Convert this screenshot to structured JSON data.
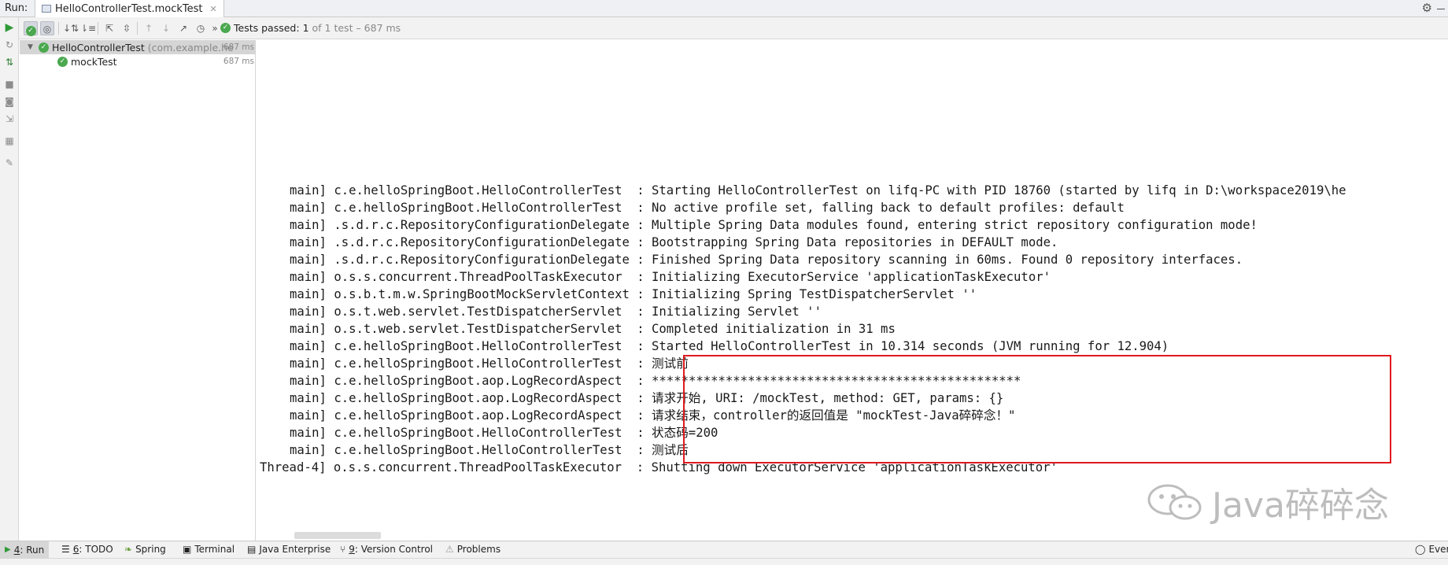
{
  "run_bar": {
    "label": "Run:",
    "tab_title": "HelloControllerTest.mockTest"
  },
  "toolbar": {
    "status_passed": "Tests passed:",
    "status_count": "1",
    "status_rest": "of 1 test – 687 ms",
    "more": "»"
  },
  "tree": {
    "root": {
      "name": "HelloControllerTest",
      "package": "(com.example.he",
      "time": "687 ms"
    },
    "child": {
      "name": "mockTest",
      "time": "687 ms"
    }
  },
  "console": {
    "lines": [
      "main] c.e.helloSpringBoot.HelloControllerTest  : Starting HelloControllerTest on lifq-PC with PID 18760 (started by lifq in D:\\workspace2019\\he",
      "main] c.e.helloSpringBoot.HelloControllerTest  : No active profile set, falling back to default profiles: default",
      "main] .s.d.r.c.RepositoryConfigurationDelegate : Multiple Spring Data modules found, entering strict repository configuration mode!",
      "main] .s.d.r.c.RepositoryConfigurationDelegate : Bootstrapping Spring Data repositories in DEFAULT mode.",
      "main] .s.d.r.c.RepositoryConfigurationDelegate : Finished Spring Data repository scanning in 60ms. Found 0 repository interfaces.",
      "main] o.s.s.concurrent.ThreadPoolTaskExecutor  : Initializing ExecutorService 'applicationTaskExecutor'",
      "main] o.s.b.t.m.w.SpringBootMockServletContext : Initializing Spring TestDispatcherServlet ''",
      "main] o.s.t.web.servlet.TestDispatcherServlet  : Initializing Servlet ''",
      "main] o.s.t.web.servlet.TestDispatcherServlet  : Completed initialization in 31 ms",
      "main] c.e.helloSpringBoot.HelloControllerTest  : Started HelloControllerTest in 10.314 seconds (JVM running for 12.904)",
      "main] c.e.helloSpringBoot.HelloControllerTest  : 测试前",
      "main] c.e.helloSpringBoot.aop.LogRecordAspect  : **************************************************",
      "main] c.e.helloSpringBoot.aop.LogRecordAspect  : 请求开始, URI: /mockTest, method: GET, params: {}",
      "main] c.e.helloSpringBoot.aop.LogRecordAspect  : 请求结束，controller的返回值是 \"mockTest-Java碎碎念！\"",
      "main] c.e.helloSpringBoot.HelloControllerTest  : 状态码=200",
      "main] c.e.helloSpringBoot.HelloControllerTest  : 测试后",
      "Thread-4] o.s.s.concurrent.ThreadPoolTaskExecutor  : Shutting down ExecutorService 'applicationTaskExecutor'"
    ]
  },
  "watermark": {
    "text": "Java碎碎念"
  },
  "bottom_bar": {
    "run_num": "4",
    "run": ": Run",
    "todo_num": "6",
    "todo": ": TODO",
    "spring": "Spring",
    "terminal": "Terminal",
    "java_enterprise": "Java Enterprise",
    "vc_num": "9",
    "vc": ": Version Control",
    "problems": "Problems",
    "event": "Even"
  },
  "colors": {
    "pass_green": "#4aa84f",
    "highlight_red": "#e0191e",
    "run_green": "#2f9a36"
  }
}
